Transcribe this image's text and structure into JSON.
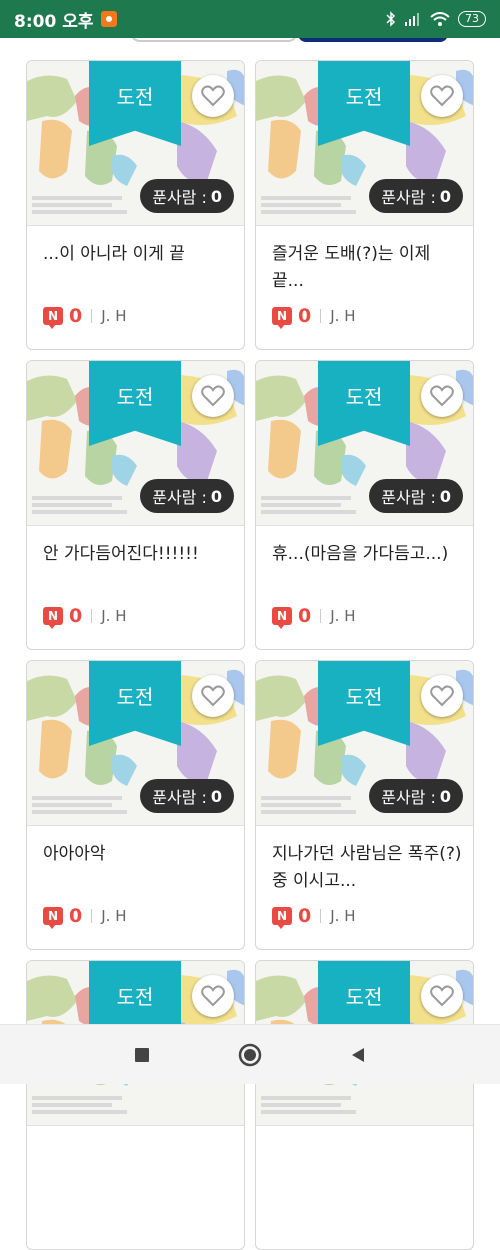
{
  "status": {
    "time": "8:00 오후",
    "battery": "73"
  },
  "cards": [
    {
      "ribbon": "도전",
      "count_label": "푼사람 :",
      "count": "0",
      "title": "...이 아니라 이게 끝",
      "badge": "N",
      "views": "0",
      "author": "J. H"
    },
    {
      "ribbon": "도전",
      "count_label": "푼사람 :",
      "count": "0",
      "title": "즐거운 도배(?)는 이제 끝...",
      "badge": "N",
      "views": "0",
      "author": "J. H"
    },
    {
      "ribbon": "도전",
      "count_label": "푼사람 :",
      "count": "0",
      "title": "안 가다듬어진다!!!!!!",
      "badge": "N",
      "views": "0",
      "author": "J. H"
    },
    {
      "ribbon": "도전",
      "count_label": "푼사람 :",
      "count": "0",
      "title": "휴...(마음을 가다듬고...)",
      "badge": "N",
      "views": "0",
      "author": "J. H"
    },
    {
      "ribbon": "도전",
      "count_label": "푼사람 :",
      "count": "0",
      "title": "아아아악",
      "badge": "N",
      "views": "0",
      "author": "J. H"
    },
    {
      "ribbon": "도전",
      "count_label": "푼사람 :",
      "count": "0",
      "title": "지나가던 사람님은 폭주(?)중 이시고...",
      "badge": "N",
      "views": "0",
      "author": "J. H"
    },
    {
      "ribbon": "도전",
      "count_label": "",
      "count": "",
      "title": "",
      "badge": "",
      "views": "",
      "author": ""
    },
    {
      "ribbon": "도전",
      "count_label": "",
      "count": "",
      "title": "",
      "badge": "",
      "views": "",
      "author": ""
    }
  ],
  "icons": {
    "heart": "heart-outline-icon",
    "nav_recents": "square-icon",
    "nav_home": "circle-icon",
    "nav_back": "triangle-back-icon"
  },
  "colors": {
    "status_bar": "#1e7a4e",
    "ribbon": "#18b1c2",
    "badge": "#ea4a44",
    "count_badge": "#2f2f2f"
  }
}
